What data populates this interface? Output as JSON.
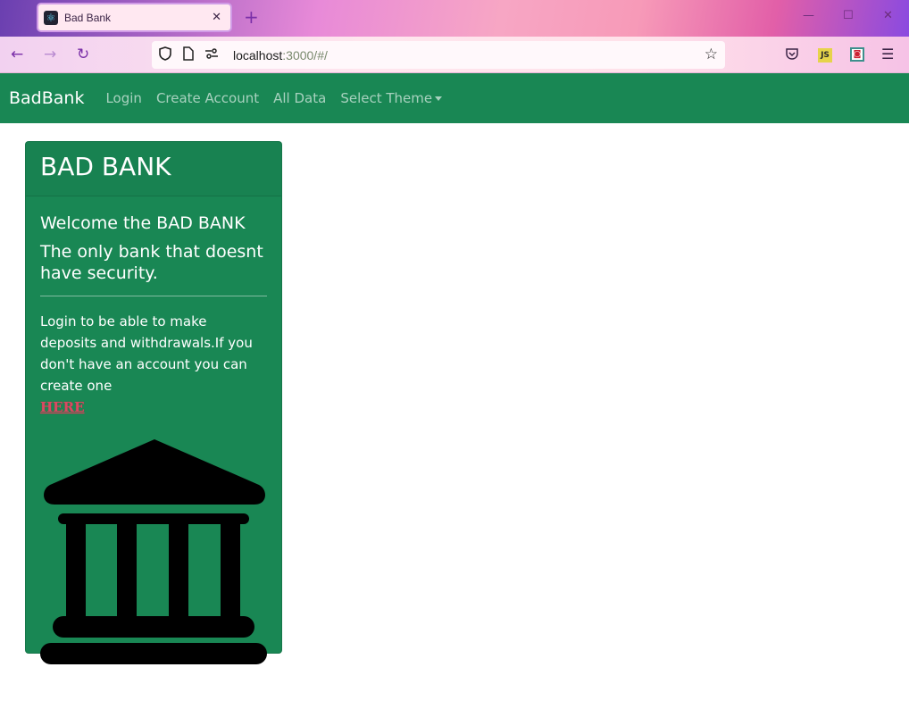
{
  "browser": {
    "tab_title": "Bad Bank",
    "tab_close": "✕",
    "new_tab": "+",
    "url_host": "localhost",
    "url_rest": ":3000/#/",
    "minimize": "—",
    "maximize": "☐",
    "close": "✕"
  },
  "navbar": {
    "brand": "BadBank",
    "links": [
      "Login",
      "Create Account",
      "All Data"
    ],
    "theme_dropdown": "Select Theme"
  },
  "card": {
    "header": "BAD BANK",
    "title": "Welcome the BAD BANK",
    "subtitle": "The only bank that doesnt have security.",
    "text": "Login to be able to make deposits and withdrawals.If you don't have an account you can create one",
    "link": "HERE",
    "icon": "bank-icon"
  },
  "colors": {
    "primary_green": "#198754",
    "link_red": "#d94a62"
  }
}
